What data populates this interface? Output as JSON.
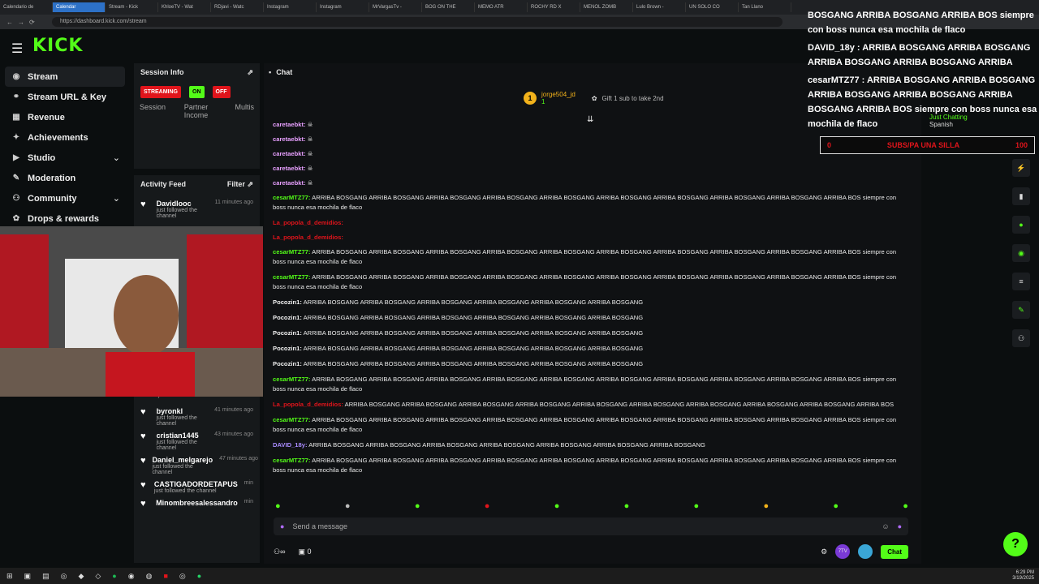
{
  "browser": {
    "tabs": [
      "Calendario de",
      "Calendar",
      "Stream - Kick",
      "KhloeTV - Wat",
      "RDjavi - Watc",
      "Instagram",
      "Instagram",
      "MrVargasTv -",
      "BOG ON THE",
      "MEMO ATR",
      "ROCHY RD X",
      "MENOL ZOMB",
      "Lulo Brown -",
      "UN SOLO CO",
      "Tan Llano"
    ],
    "url": "https://dashboard.kick.com/stream"
  },
  "logo": "KICK",
  "sidebar": [
    {
      "label": "Stream",
      "icon": "broadcast-icon"
    },
    {
      "label": "Stream URL & Key",
      "icon": "link-icon"
    },
    {
      "label": "Revenue",
      "icon": "chart-icon"
    },
    {
      "label": "Achievements",
      "icon": "star-icon"
    },
    {
      "label": "Studio",
      "icon": "studio-icon"
    },
    {
      "label": "Moderation",
      "icon": "wrench-icon"
    },
    {
      "label": "Community",
      "icon": "people-icon"
    },
    {
      "label": "Drops & rewards",
      "icon": "gift-icon"
    }
  ],
  "session": {
    "title": "Session Info",
    "badges": [
      "STREAMING",
      "ON",
      "OFF"
    ],
    "labels": [
      "Session",
      "Partner Income",
      "Multis"
    ]
  },
  "activity": {
    "title": "Activity Feed",
    "filter": "Filter",
    "items": [
      {
        "user": "Davidlooc",
        "status": "just followed the channel",
        "time": "11 minutes ago"
      },
      {
        "user": "",
        "status": "just followed the channel",
        "time": ""
      },
      {
        "user": "byronkl",
        "status": "just followed the channel",
        "time": "41 minutes ago"
      },
      {
        "user": "cristian1445",
        "status": "just followed the channel",
        "time": "43 minutes ago"
      },
      {
        "user": "Daniel_melgarejo",
        "status": "just followed the channel",
        "time": "47 minutes ago"
      },
      {
        "user": "CASTIGADORDETAPUS",
        "status": "just followed the channel",
        "time": "min"
      },
      {
        "user": "Minombreesalessandro",
        "status": "",
        "time": "min"
      }
    ]
  },
  "chat": {
    "title": "Chat",
    "pinned_user": "jorge504_jd",
    "pinned_rank": "1",
    "pinned_sub": "1",
    "gift_text": "Gift 1 sub to take 2nd",
    "messages": [
      {
        "user": "caretaebkt:",
        "color": "#e8a0ff",
        "text": "☠"
      },
      {
        "user": "caretaebkt:",
        "color": "#e8a0ff",
        "text": "☠"
      },
      {
        "user": "caretaebkt:",
        "color": "#e8a0ff",
        "text": "☠"
      },
      {
        "user": "caretaebkt:",
        "color": "#e8a0ff",
        "text": "☠"
      },
      {
        "user": "caretaebkt:",
        "color": "#e8a0ff",
        "text": "☠"
      },
      {
        "user": "cesarMTZ77:",
        "color": "#53fc18",
        "text": "ARRIBA BOSGANG ARRIBA BOSGANG ARRIBA BOSGANG ARRIBA BOSGANG ARRIBA BOSGANG ARRIBA BOSGANG ARRIBA BOSGANG ARRIBA BOSGANG ARRIBA BOSGANG ARRIBA BOS siempre con boss nunca esa mochila de flaco"
      },
      {
        "user": "La_popola_d_demidios:",
        "color": "#e0141b",
        "text": ""
      },
      {
        "user": "La_popola_d_demidios:",
        "color": "#e0141b",
        "text": ""
      },
      {
        "user": "cesarMTZ77:",
        "color": "#53fc18",
        "text": "ARRIBA BOSGANG ARRIBA BOSGANG ARRIBA BOSGANG ARRIBA BOSGANG ARRIBA BOSGANG ARRIBA BOSGANG ARRIBA BOSGANG ARRIBA BOSGANG ARRIBA BOSGANG ARRIBA BOS siempre con boss nunca esa mochila de flaco"
      },
      {
        "user": "cesarMTZ77:",
        "color": "#53fc18",
        "text": "ARRIBA BOSGANG ARRIBA BOSGANG ARRIBA BOSGANG ARRIBA BOSGANG ARRIBA BOSGANG ARRIBA BOSGANG ARRIBA BOSGANG ARRIBA BOSGANG ARRIBA BOSGANG ARRIBA BOS siempre con boss nunca esa mochila de flaco"
      },
      {
        "user": "Pocozin1:",
        "color": "#f0f0f0",
        "text": "ARRIBA BOSGANG ARRIBA BOSGANG ARRIBA BOSGANG ARRIBA BOSGANG ARRIBA BOSGANG ARRIBA BOSGANG"
      },
      {
        "user": "Pocozin1:",
        "color": "#f0f0f0",
        "text": "ARRIBA BOSGANG ARRIBA BOSGANG ARRIBA BOSGANG ARRIBA BOSGANG ARRIBA BOSGANG ARRIBA BOSGANG"
      },
      {
        "user": "Pocozin1:",
        "color": "#f0f0f0",
        "text": "ARRIBA BOSGANG ARRIBA BOSGANG ARRIBA BOSGANG ARRIBA BOSGANG ARRIBA BOSGANG ARRIBA BOSGANG"
      },
      {
        "user": "Pocozin1:",
        "color": "#f0f0f0",
        "text": "ARRIBA BOSGANG ARRIBA BOSGANG ARRIBA BOSGANG ARRIBA BOSGANG ARRIBA BOSGANG ARRIBA BOSGANG"
      },
      {
        "user": "Pocozin1:",
        "color": "#f0f0f0",
        "text": "ARRIBA BOSGANG ARRIBA BOSGANG ARRIBA BOSGANG ARRIBA BOSGANG ARRIBA BOSGANG ARRIBA BOSGANG"
      },
      {
        "user": "cesarMTZ77:",
        "color": "#53fc18",
        "text": "ARRIBA BOSGANG ARRIBA BOSGANG ARRIBA BOSGANG ARRIBA BOSGANG ARRIBA BOSGANG ARRIBA BOSGANG ARRIBA BOSGANG ARRIBA BOSGANG ARRIBA BOSGANG ARRIBA BOS siempre con boss nunca esa mochila de flaco"
      },
      {
        "user": "La_popola_d_demidios:",
        "color": "#e0141b",
        "text": "ARRIBA BOSGANG ARRIBA BOSGANG ARRIBA BOSGANG ARRIBA BOSGANG ARRIBA BOSGANG ARRIBA BOSGANG ARRIBA BOSGANG ARRIBA BOSGANG ARRIBA BOSGANG ARRIBA BOS"
      },
      {
        "user": "cesarMTZ77:",
        "color": "#53fc18",
        "text": "ARRIBA BOSGANG ARRIBA BOSGANG ARRIBA BOSGANG ARRIBA BOSGANG ARRIBA BOSGANG ARRIBA BOSGANG ARRIBA BOSGANG ARRIBA BOSGANG ARRIBA BOSGANG ARRIBA BOS siempre con boss nunca esa mochila de flaco"
      },
      {
        "user": "DAVID_18y:",
        "color": "#a98cff",
        "text": "ARRIBA BOSGANG ARRIBA BOSGANG ARRIBA BOSGANG ARRIBA BOSGANG ARRIBA BOSGANG ARRIBA BOSGANG ARRIBA BOSGANG"
      },
      {
        "user": "cesarMTZ77:",
        "color": "#53fc18",
        "text": "ARRIBA BOSGANG ARRIBA BOSGANG ARRIBA BOSGANG ARRIBA BOSGANG ARRIBA BOSGANG ARRIBA BOSGANG ARRIBA BOSGANG ARRIBA BOSGANG ARRIBA BOSGANG ARRIBA BOS siempre con boss nunca esa mochila de flaco"
      }
    ],
    "input_placeholder": "Send a message",
    "footer_count": "0",
    "chat_button": "Chat"
  },
  "overlay": {
    "line1": "BOSGANG ARRIBA BOSGANG ARRIBA BOS siempre con boss nunca esa mochila de flaco",
    "line2": "DAVID_18y : ARRIBA BOSGANG ARRIBA BOSGANG ARRIBA BOSGANG ARRIBA BOSGANG ARRIBA",
    "line3": "cesarMTZ77 : ARRIBA BOSGANG ARRIBA BOSGANG ARRIBA BOSGANG ARRIBA BOSGANG ARRIBA BOSGANG ARRIBA BOS siempre con boss nunca esa mochila de flaco",
    "subs_left": "0",
    "subs_text": "SUBS/PA UNA SILLA",
    "subs_right": "100",
    "category": "Just Chatting",
    "language": "Spanish"
  },
  "colors": {
    "accent": "#53fc18",
    "live": "#e0141b"
  },
  "taskbar": {
    "time": "6:29 PM",
    "date": "3/19/2025"
  }
}
